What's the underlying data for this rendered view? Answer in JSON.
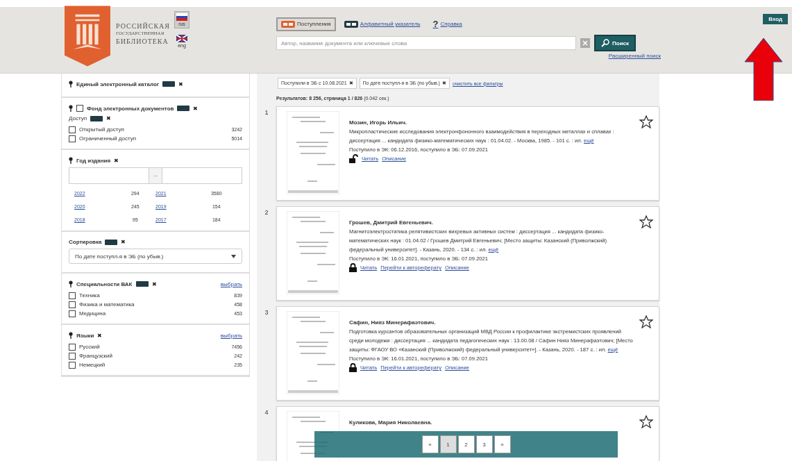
{
  "logo": {
    "lines": [
      "РОССИЙСКАЯ",
      "ГОСУДАРСТВЕННАЯ",
      "БИБЛИОТЕКА"
    ]
  },
  "languages": [
    {
      "label": "rus",
      "selected": true
    },
    {
      "label": "eng",
      "selected": false
    }
  ],
  "tabs": [
    {
      "label": "Поступления",
      "selected": true,
      "kind": "arrivals"
    },
    {
      "label": "Алфавитный указатель",
      "selected": false,
      "kind": "index"
    },
    {
      "label": "Справка",
      "selected": false,
      "kind": "help",
      "icon": "?"
    }
  ],
  "search": {
    "placeholder": "Автор, название документа или ключевые слова",
    "button": "Поиск",
    "advanced": "Расширенный поиск"
  },
  "login": "Вход",
  "sidebar": [
    {
      "kind": "checklist",
      "title": "Единый электронный каталог",
      "badge": true,
      "remove": "✖"
    },
    {
      "kind": "checklist",
      "title": "Фонд электронных документов",
      "checked": false,
      "badge": true,
      "remove": "✖",
      "subtitle": "Доступ",
      "subbadge": true,
      "subremove": "✖",
      "options": [
        {
          "label": "Открытый доступ",
          "count": "3242",
          "checked": false
        },
        {
          "label": "Ограниченный доступ",
          "count": "5014",
          "checked": false
        }
      ]
    },
    {
      "kind": "years",
      "title": "Год издания",
      "remove": "✖",
      "range_sep": "–",
      "years": [
        {
          "year": "2022",
          "count": "294"
        },
        {
          "year": "2021",
          "count": "3580"
        },
        {
          "year": "2020",
          "count": "245"
        },
        {
          "year": "2019",
          "count": "154"
        },
        {
          "year": "2018",
          "count": "95"
        },
        {
          "year": "2017",
          "count": "184"
        }
      ]
    },
    {
      "kind": "select",
      "title": "Сортировка",
      "badge": true,
      "remove": "✖",
      "value": "По дате поступл-я в ЭБ (по убыв.)"
    },
    {
      "kind": "checklist",
      "title": "Специальности ВАК",
      "badge": true,
      "remove": "✖",
      "action": "выбрать",
      "options": [
        {
          "label": "Техника",
          "count": "839",
          "checked": false
        },
        {
          "label": "Физика и математика",
          "count": "458",
          "checked": false
        },
        {
          "label": "Медицина",
          "count": "453",
          "checked": false
        }
      ]
    },
    {
      "kind": "checklist",
      "title": "Языки",
      "remove": "✖",
      "action": "выбрать",
      "options": [
        {
          "label": "Русский",
          "count": "7456",
          "checked": false
        },
        {
          "label": "Французский",
          "count": "242",
          "checked": false
        },
        {
          "label": "Немецкий",
          "count": "235",
          "checked": false
        }
      ]
    }
  ],
  "filters": [
    {
      "label": "Поступили в ЭБ с 10.08.2021",
      "remove": "✖"
    },
    {
      "label": "По дате поступл-я в ЭБ (по убыв.)",
      "remove": "✖"
    }
  ],
  "clear_filters": "очистить все фильтры",
  "summary": "**Результатов: 8 256, страница 1 / 826** (0.042 сек.)",
  "results": [
    {
      "number": "1",
      "author": "Мозин, Игорь Ильич.",
      "text": "Микропластические исследования электронфононного взаимодействия в переходных металлах и сплавах : диссертация ... кандидата физико-математических наук : 01.04.02. - Москва, 1985. - 101 с. : ил.",
      "more": "ещё",
      "dates": "Поступило в ЭК: 06.12.2016, поступило в ЭБ: 07.09.2021",
      "kind": "open",
      "links": [
        "Читать",
        "Описание"
      ]
    },
    {
      "number": "2",
      "author": "Грошев, Дмитрий Евгеньевич.",
      "text": "Магнитоэлектростатика релятивистских вихревых активных систем : диссертация ... кандидата физико-математических наук : 01.04.02 / Грошев Дмитрий Евгеньевич; [Место защиты: Казанский (Приволжский) федеральный университет]. - Казань, 2020. - 134 с. : ил.",
      "more": "ещё",
      "dates": "Поступило в ЭК: 16.01.2021, поступило в ЭБ: 07.09.2021",
      "kind": "closed",
      "links": [
        "Читать",
        "Перейти к автореферату",
        "Описание"
      ]
    },
    {
      "number": "3",
      "author": "Сафин, Нияз Минерафаэтович.",
      "text": "Подготовка курсантов образовательных организаций МВД России к профилактике экстремистских проявлений среди молодежи : диссертация ... кандидата педагогических наук : 13.00.08 / Сафин Нияз Минерафаэтович; [Место защиты: ФГАОУ ВО «Казанский (Приволжский) федеральный университет»]. - Казань, 2020. - 187 с. : ил.",
      "more": "ещё",
      "dates": "Поступило в ЭК: 16.01.2021, поступило в ЭБ: 07.09.2021",
      "kind": "closed",
      "links": [
        "Читать",
        "Перейти к автореферату",
        "Описание"
      ]
    },
    {
      "number": "4",
      "author": "Куликова, Мария Николаевна."
    }
  ],
  "pagination": [
    {
      "label": "«",
      "selected": false
    },
    {
      "label": "1",
      "selected": true
    },
    {
      "label": "2",
      "selected": false
    },
    {
      "label": "3",
      "selected": false
    },
    {
      "label": "»",
      "selected": false
    }
  ]
}
